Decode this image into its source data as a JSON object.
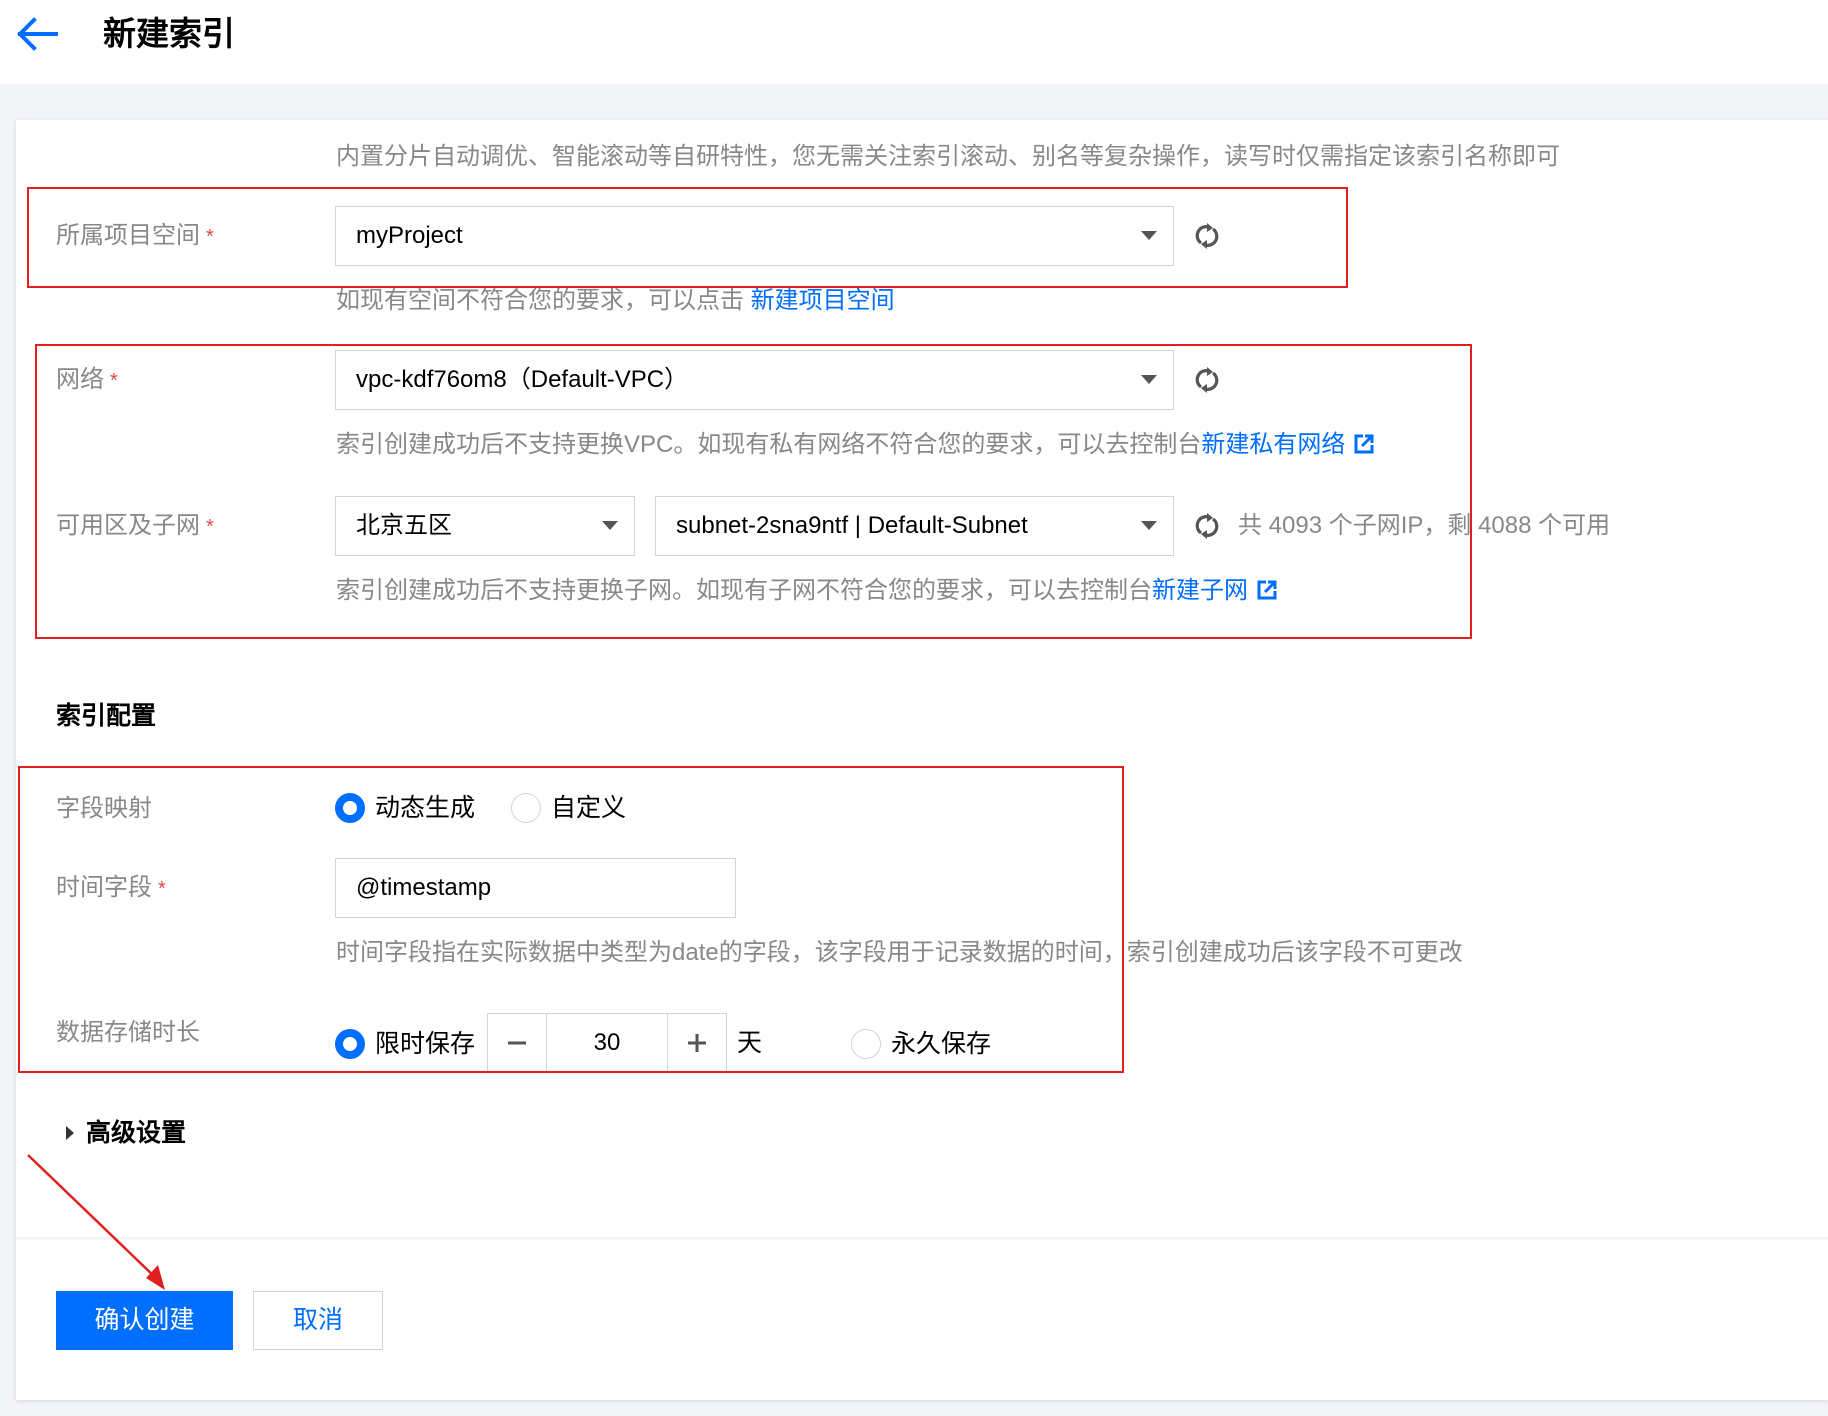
{
  "header": {
    "title": "新建索引"
  },
  "intro": {
    "text": "内置分片自动调优、智能滚动等自研特性，您无需关注索引滚动、别名等复杂操作，读写时仅需指定该索引名称即可"
  },
  "project": {
    "label": "所属项目空间",
    "required": "*",
    "value": "myProject",
    "help_prefix": "如现有空间不符合您的要求，可以点击 ",
    "help_link": "新建项目空间"
  },
  "network": {
    "label": "网络",
    "required": "*",
    "value": "vpc-kdf76om8（Default-VPC）",
    "help_prefix": "索引创建成功后不支持更换VPC。如现有私有网络不符合您的要求，可以去控制台",
    "help_link": "新建私有网络"
  },
  "zone": {
    "label": "可用区及子网",
    "required": "*",
    "zone_value": "北京五区",
    "subnet_value": "subnet-2sna9ntf | Default-Subnet",
    "ip_info": "共 4093 个子网IP，剩 4088 个可用",
    "help_prefix": "索引创建成功后不支持更换子网。如现有子网不符合您的要求，可以去控制台",
    "help_link": "新建子网"
  },
  "index_config": {
    "title": "索引配置",
    "field_mapping": {
      "label": "字段映射",
      "options": [
        "动态生成",
        "自定义"
      ],
      "selected": "动态生成"
    },
    "time_field": {
      "label": "时间字段",
      "required": "*",
      "value": "@timestamp",
      "help": "时间字段指在实际数据中类型为date的字段，该字段用于记录数据的时间，索引创建成功后该字段不可更改"
    },
    "retention": {
      "label": "数据存储时长",
      "limited_label": "限时保存",
      "days": "30",
      "unit": "天",
      "permanent_label": "永久保存",
      "selected": "限时保存"
    }
  },
  "advanced": {
    "label": "高级设置"
  },
  "footer": {
    "confirm_label": "确认创建",
    "cancel_label": "取消"
  },
  "colors": {
    "primary": "#006eff",
    "required": "#e54545",
    "annotation": "#e02020"
  }
}
